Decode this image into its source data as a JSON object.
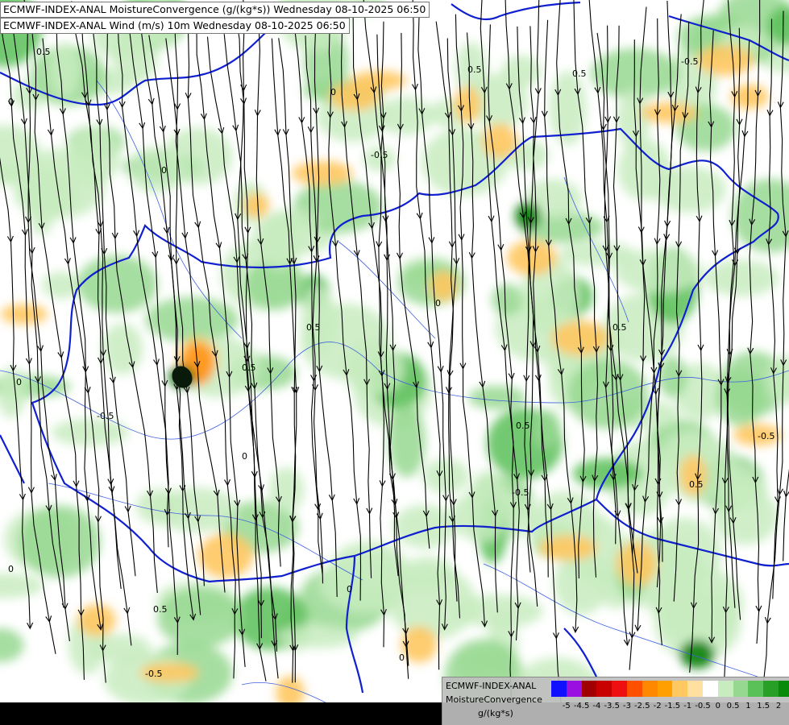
{
  "header": {
    "line1": "ECMWF-INDEX-ANAL MoistureConvergence (g/(kg*s)) Wednesday 08-10-2025 06:50",
    "line2": "ECMWF-INDEX-ANAL Wind (m/s) 10m Wednesday 08-10-2025 06:50"
  },
  "legend": {
    "title": "ECMWF-INDEX-ANAL",
    "subtitle": "MoistureConvergence",
    "unit": "g/(kg*s)",
    "colors": [
      "#1010ff",
      "#9a10e0",
      "#a00000",
      "#c80000",
      "#ee1010",
      "#ff5000",
      "#ff8800",
      "#ffa000",
      "#ffc860",
      "#ffe0a0",
      "#ffffff",
      "#c8ecc0",
      "#96d890",
      "#5ac058",
      "#28a028",
      "#0a8a0a"
    ],
    "tick_labels": [
      "-5",
      "-4.5",
      "-4",
      "-3.5",
      "-3",
      "-2.5",
      "-2",
      "-1.5",
      "-1",
      "-0.5",
      "0",
      "0.5",
      "1",
      "1.5",
      "2"
    ]
  },
  "map": {
    "background_color": "#ffffff",
    "border_color": "#1020d0",
    "river_color": "#4060e0",
    "streamline_color": "#000000",
    "contour_labels": [
      "0.5",
      "0",
      "-0.5",
      "0",
      "0.5",
      "0.5",
      "0",
      "-0.5",
      "0",
      "0.5",
      "0",
      "-0.5",
      "0",
      "0.5",
      "-0.5",
      "0.5",
      "0",
      "-0.5",
      "0.5",
      "0",
      "0.5",
      "-0.5",
      "0",
      "0.5"
    ]
  }
}
